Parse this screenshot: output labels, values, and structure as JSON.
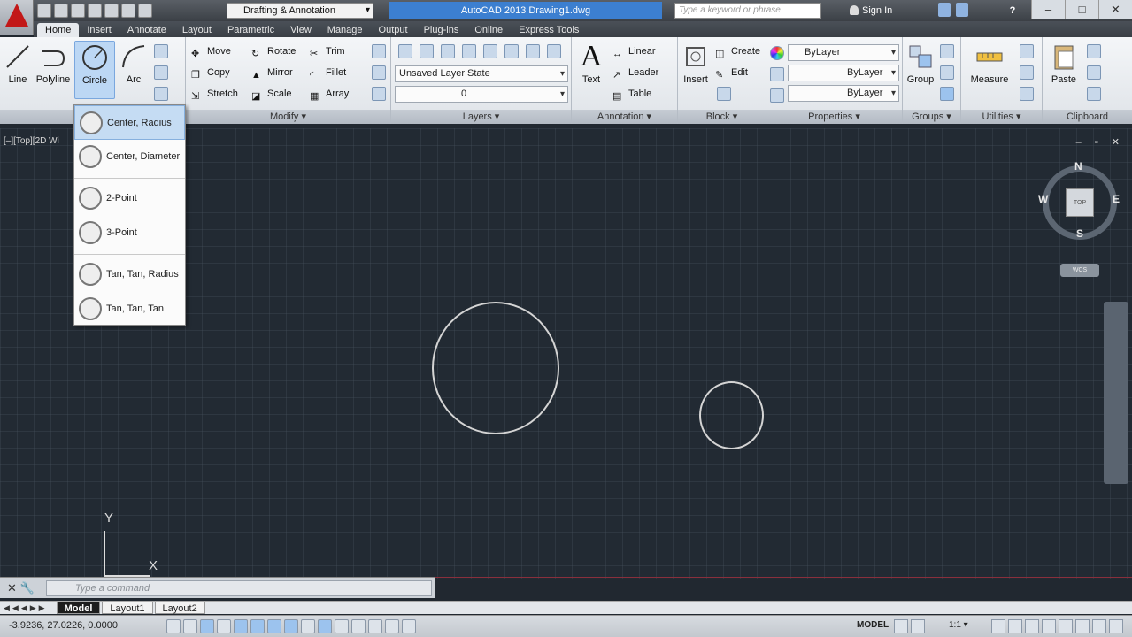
{
  "window": {
    "title": "AutoCAD 2013   Drawing1.dwg",
    "workspace": "Drafting & Annotation",
    "search_placeholder": "Type a keyword or phrase",
    "sign_in": "Sign In",
    "help_label": "?",
    "controls": {
      "minimize": "–",
      "maximize": "□",
      "close": "✕"
    }
  },
  "ribbon_tabs": [
    "Home",
    "Insert",
    "Annotate",
    "Layout",
    "Parametric",
    "View",
    "Manage",
    "Output",
    "Plug-ins",
    "Online",
    "Express Tools"
  ],
  "draw": {
    "line": "Line",
    "polyline": "Polyline",
    "circle": "Circle",
    "arc": "Arc"
  },
  "modify": {
    "title": "Modify ▾",
    "move": "Move",
    "rotate": "Rotate",
    "trim": "Trim",
    "copy": "Copy",
    "mirror": "Mirror",
    "fillet": "Fillet",
    "stretch": "Stretch",
    "scale": "Scale",
    "array": "Array"
  },
  "layers": {
    "title": "Layers ▾",
    "layer_state": "Unsaved Layer State",
    "current_layer": "0"
  },
  "annotation": {
    "title": "Annotation ▾",
    "text": "Text",
    "linear": "Linear",
    "leader": "Leader",
    "table": "Table"
  },
  "block": {
    "title": "Block ▾",
    "insert": "Insert",
    "create": "Create",
    "edit": "Edit"
  },
  "properties": {
    "title": "Properties ▾",
    "color": "ByLayer",
    "linetype": "ByLayer",
    "lineweight": "ByLayer"
  },
  "groups": {
    "title": "Groups ▾",
    "group": "Group"
  },
  "utilities": {
    "title": "Utilities ▾",
    "measure": "Measure"
  },
  "clipboard": {
    "title": "Clipboard",
    "paste": "Paste"
  },
  "circle_menu": [
    {
      "label": "Center, Radius"
    },
    {
      "label": "Center, Diameter"
    },
    {
      "label": "2-Point"
    },
    {
      "label": "3-Point"
    },
    {
      "label": "Tan, Tan, Radius"
    },
    {
      "label": "Tan, Tan, Tan"
    }
  ],
  "viewport": {
    "label": "[–][Top][2D Wi",
    "compass": {
      "n": "N",
      "s": "S",
      "e": "E",
      "w": "W",
      "cube": "TOP"
    },
    "wcs": "WCS",
    "ucs_x": "X",
    "ucs_y": "Y"
  },
  "command": {
    "placeholder": "Type a command"
  },
  "layout_tabs": [
    "Model",
    "Layout1",
    "Layout2"
  ],
  "status": {
    "coords": "-3.9236, 27.0226, 0.0000",
    "model": "MODEL",
    "scale": "1:1 ▾"
  }
}
